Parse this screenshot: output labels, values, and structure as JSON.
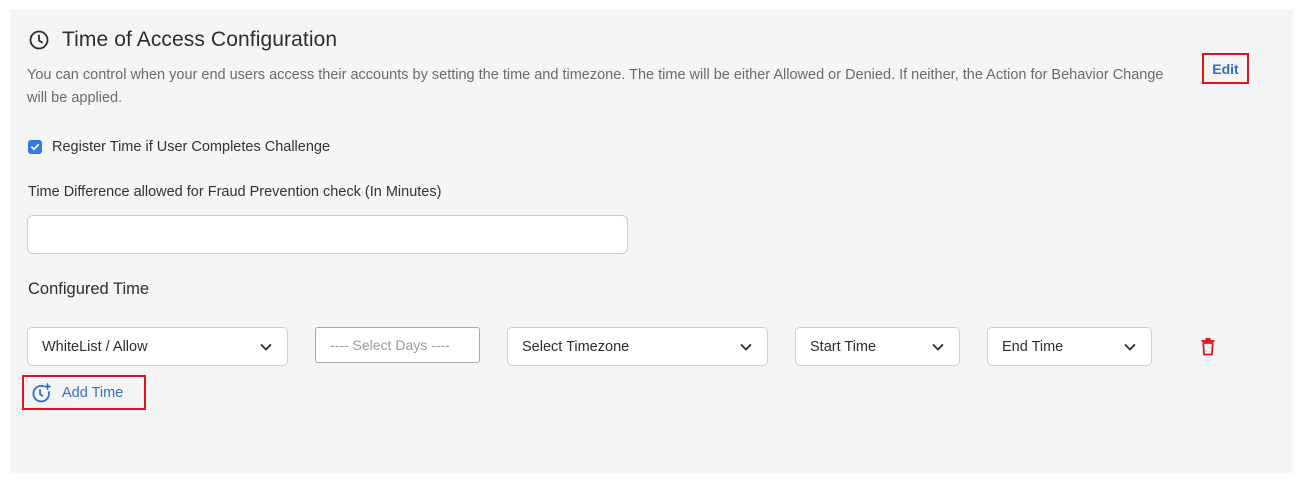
{
  "section": {
    "title": "Time of Access Configuration",
    "description": "You can control when your end users access their accounts by setting the time and timezone. The time will be either Allowed or Denied. If neither, the Action for Behavior Change will be applied.",
    "edit_label": "Edit"
  },
  "register_checkbox": {
    "label": "Register Time if User Completes Challenge",
    "checked": true
  },
  "time_difference": {
    "label": "Time Difference allowed for Fraud Prevention check (In Minutes)",
    "value": ""
  },
  "configured_time": {
    "title": "Configured Time",
    "row": {
      "access_type": "WhiteList / Allow",
      "days_placeholder": "---- Select Days ----",
      "timezone": "Select Timezone",
      "start_time": "Start Time",
      "end_time": "End Time"
    },
    "add_label": "Add Time"
  },
  "colors": {
    "accent_blue": "#2f6fc3",
    "checkbox_blue": "#2f7be0",
    "delete_red": "#e2121e",
    "highlight_red": "#e2121e"
  },
  "icons": {
    "title": "clock-icon",
    "checkbox": "check-icon",
    "dropdown": "chevron-down-icon",
    "delete": "trash-icon",
    "add": "clock-plus-icon"
  }
}
